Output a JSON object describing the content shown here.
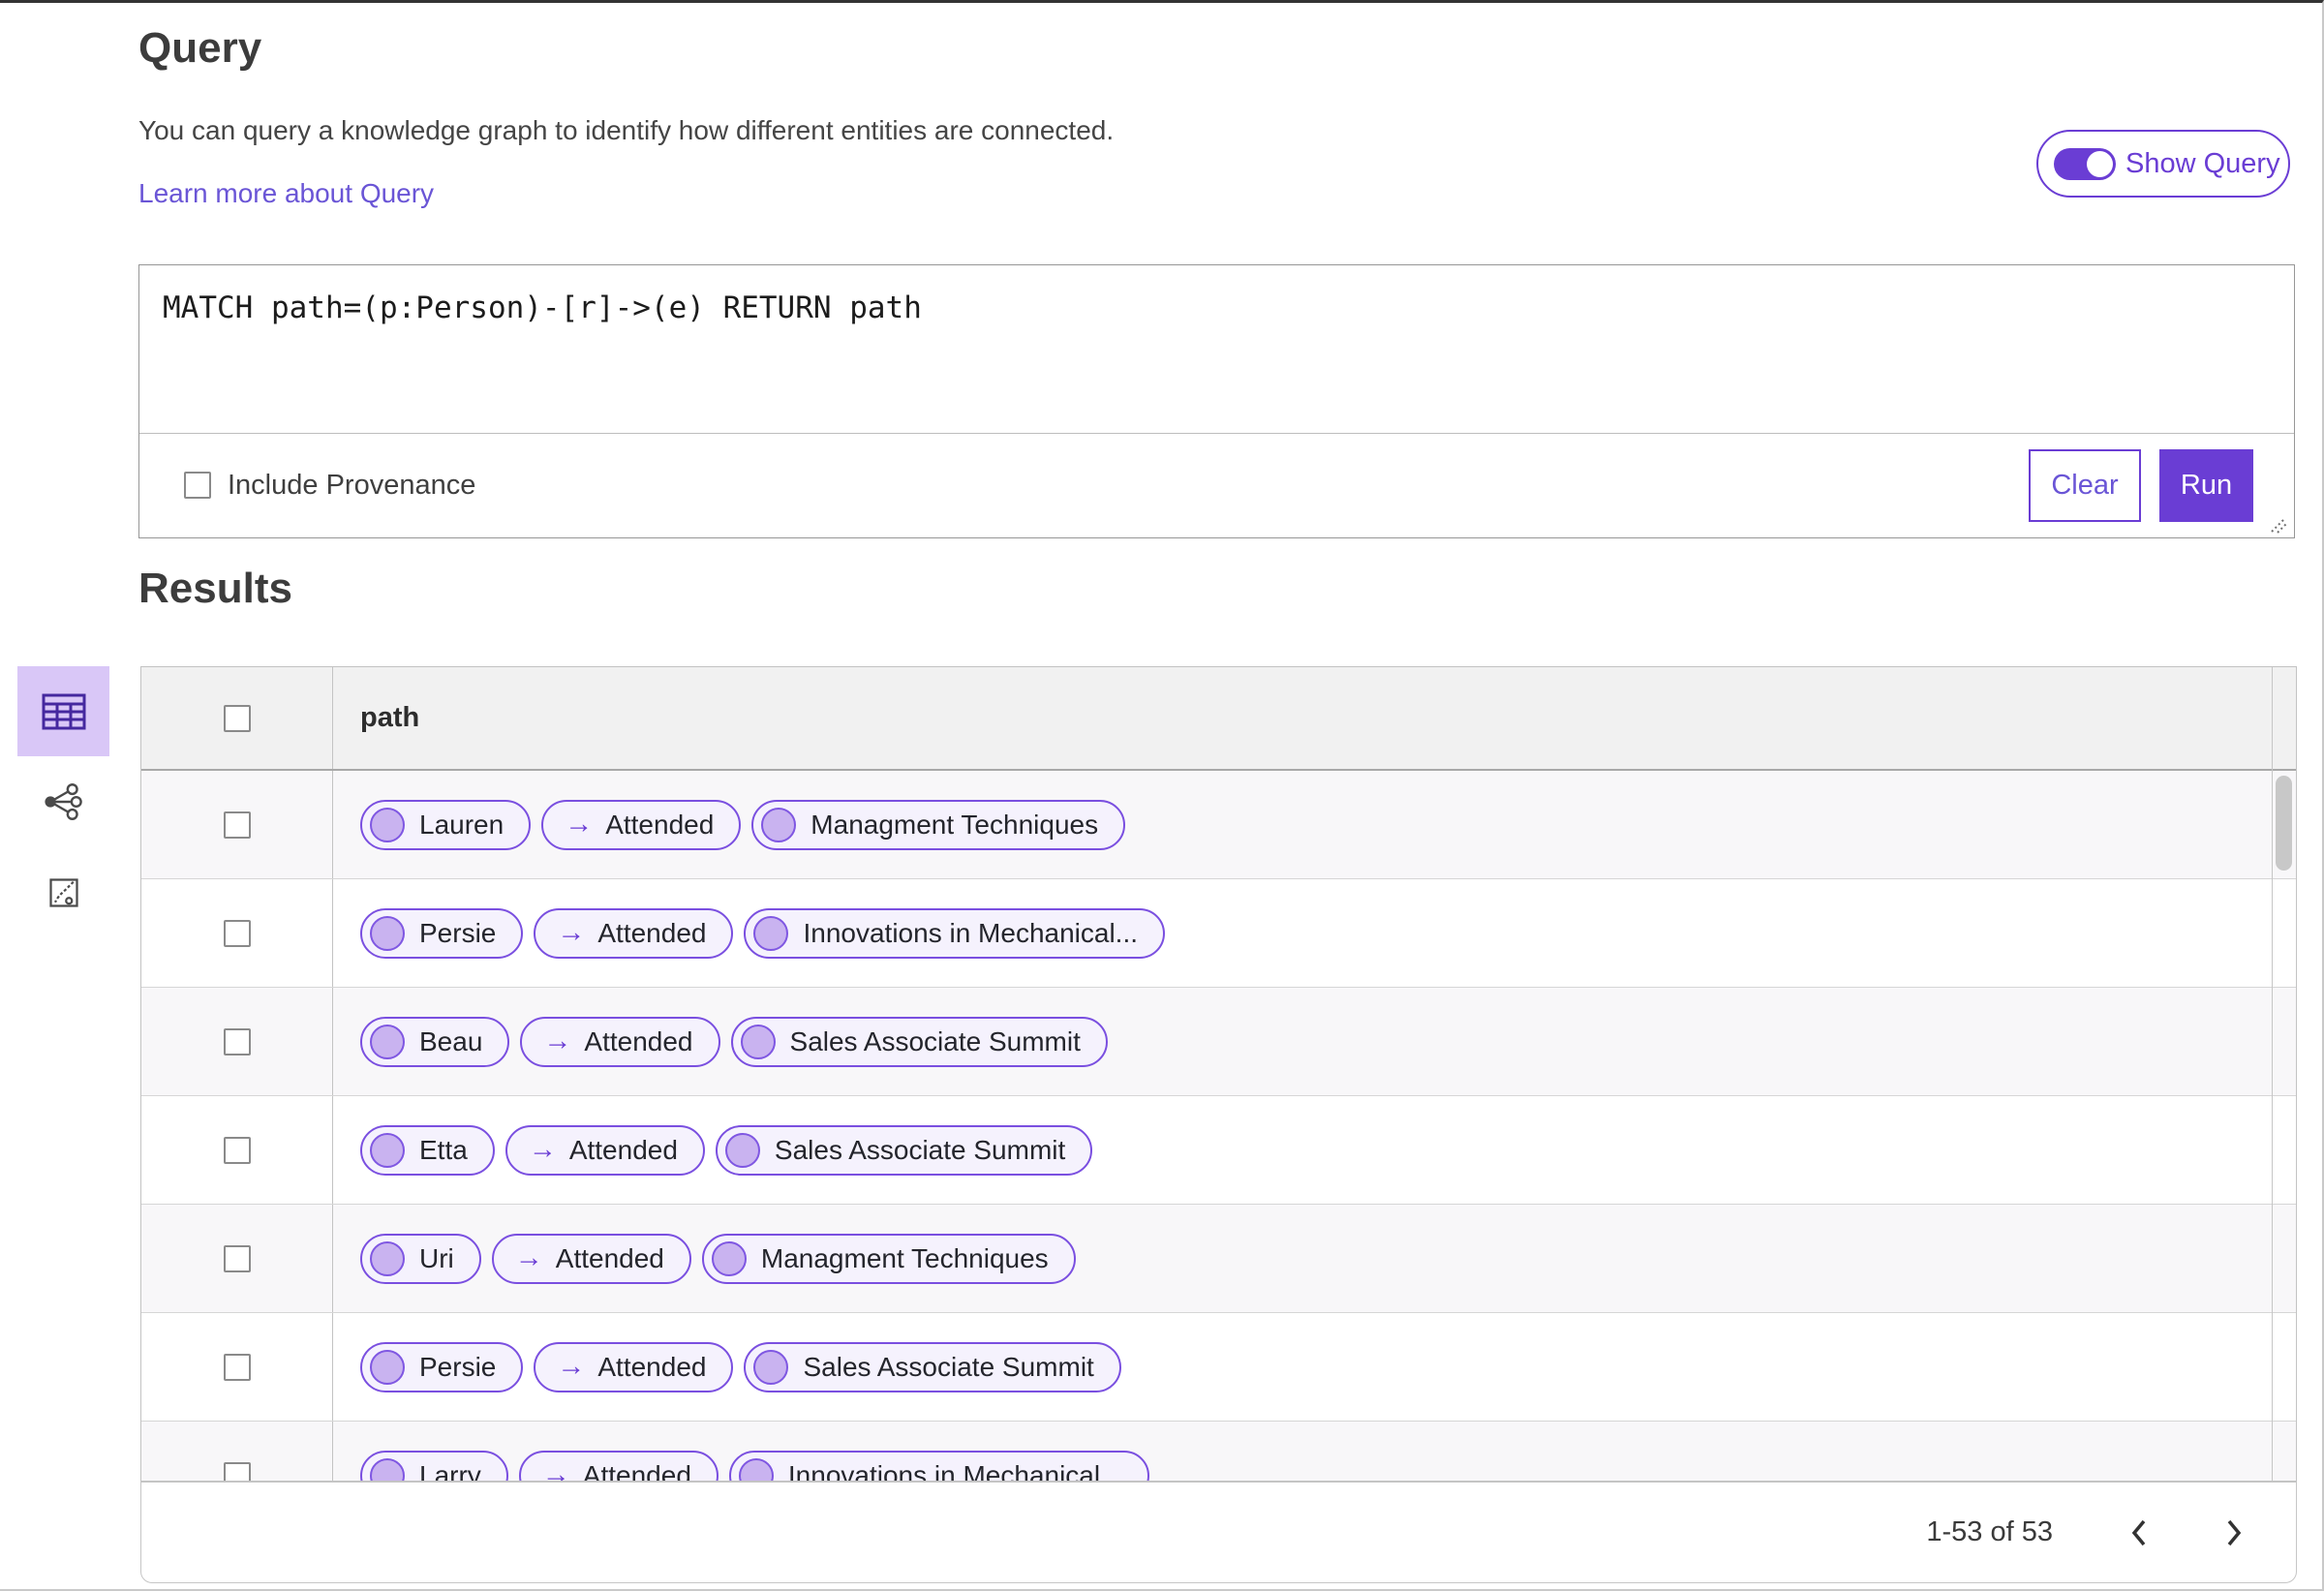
{
  "header": {
    "title": "Query",
    "description": "You can query a knowledge graph to identify how different entities are connected.",
    "learn_more_link": "Learn more about Query",
    "show_query_toggle": "Show Query"
  },
  "query_editor": {
    "text": "MATCH path=(p:Person)-[r]->(e) RETURN path",
    "include_provenance_label": "Include Provenance",
    "include_provenance_checked": false,
    "clear_button": "Clear",
    "run_button": "Run"
  },
  "results": {
    "title": "Results",
    "view_switcher": {
      "options": [
        {
          "name": "table-view",
          "selected": true
        },
        {
          "name": "graph-view",
          "selected": false
        },
        {
          "name": "chart-view",
          "selected": false
        }
      ]
    },
    "table": {
      "column_header": "path",
      "edge_arrow": "→",
      "rows": [
        {
          "source": "Lauren",
          "edge": "Attended",
          "target": "Managment Techniques"
        },
        {
          "source": "Persie",
          "edge": "Attended",
          "target": "Innovations in Mechanical..."
        },
        {
          "source": "Beau",
          "edge": "Attended",
          "target": "Sales Associate Summit"
        },
        {
          "source": "Etta",
          "edge": "Attended",
          "target": "Sales Associate Summit"
        },
        {
          "source": "Uri",
          "edge": "Attended",
          "target": "Managment Techniques"
        },
        {
          "source": "Persie",
          "edge": "Attended",
          "target": "Sales Associate Summit"
        },
        {
          "source": "Larry",
          "edge": "Attended",
          "target": "Innovations in Mechanical..."
        }
      ]
    },
    "pagination": {
      "range": "1-53 of 53"
    }
  },
  "colors": {
    "primary_purple": "#6a3dd4",
    "pill_border": "#7a4fe0",
    "pill_background": "#f5f2fd",
    "node_dot_fill": "#c9b3f0",
    "selected_tile_background": "#d9c7f7",
    "header_row_background": "#f1f1f1",
    "striped_row_background": "#f8f7f9"
  }
}
